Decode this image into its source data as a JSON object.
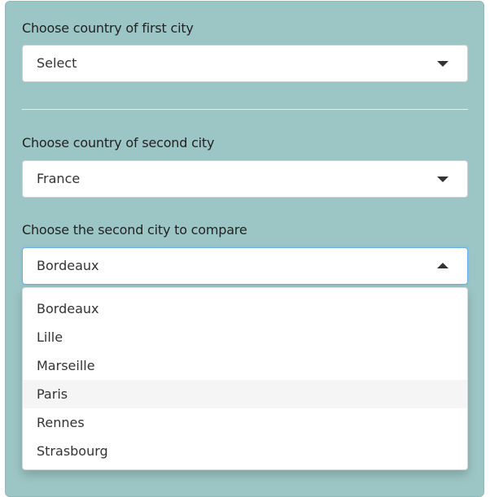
{
  "first_city_country": {
    "label": "Choose country of first city",
    "selected": "Select"
  },
  "second_city_country": {
    "label": "Choose country of second city",
    "selected": "France"
  },
  "second_city": {
    "label": "Choose the second city to compare",
    "selected": "Bordeaux",
    "options": [
      "Bordeaux",
      "Lille",
      "Marseille",
      "Paris",
      "Rennes",
      "Strasbourg"
    ],
    "hovered_option": "Paris"
  },
  "colors": {
    "panel_background": "#9cc6c5",
    "focus_border": "#66afe9",
    "hover_background": "#f5f5f5"
  }
}
